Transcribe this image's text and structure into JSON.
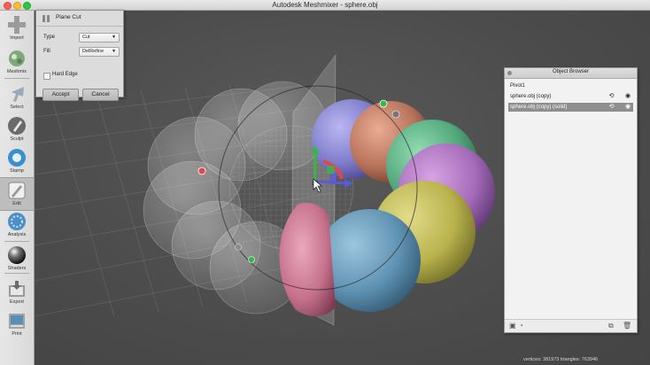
{
  "window": {
    "title": "Autodesk Meshmixer - sphere.obj"
  },
  "toolbar": {
    "items": [
      {
        "label": "Import",
        "icon": "plus-icon"
      },
      {
        "label": "Meshmix",
        "icon": "meshmix-icon"
      },
      {
        "label": "Select",
        "icon": "select-arrow-icon"
      },
      {
        "label": "Sculpt",
        "icon": "brush-icon"
      },
      {
        "label": "Stamp",
        "icon": "stamp-icon"
      },
      {
        "label": "Edit",
        "icon": "edit-icon"
      },
      {
        "label": "Analysis",
        "icon": "analysis-icon"
      },
      {
        "label": "Shaders",
        "icon": "shader-sphere-icon"
      },
      {
        "label": "Export",
        "icon": "export-icon"
      },
      {
        "label": "Print",
        "icon": "print-icon"
      }
    ],
    "active": "Edit"
  },
  "plane_cut": {
    "title": "Plane Cut",
    "type_label": "Type",
    "type_value": "Cut",
    "fill_label": "Fill",
    "fill_value": "DelRefine",
    "hard_edge_label": "Hard Edge",
    "hard_edge_checked": false,
    "accept_label": "Accept",
    "cancel_label": "Cancel"
  },
  "object_browser": {
    "title": "Object Browser",
    "items": [
      {
        "name": "Pivot1",
        "selected": false,
        "has_icons": false
      },
      {
        "name": "sphere.obj (copy)",
        "selected": false,
        "has_icons": true
      },
      {
        "name": "sphere.obj (copy) (solid)",
        "selected": true,
        "has_icons": true
      }
    ],
    "footer_icons": [
      "cube-icon",
      "pie-icon",
      "duplicate-icon",
      "trash-icon"
    ]
  },
  "status": {
    "stats_text": "vertices: 381973  triangles: 763946"
  },
  "colors": {
    "sphere_blue": "#6a9dbd",
    "sphere_pink": "#d07f98",
    "sphere_yellow": "#c9c25a",
    "sphere_purple": "#b678c9",
    "sphere_green": "#5fb889",
    "sphere_orange": "#c7826a",
    "sphere_violet": "#8a88d6",
    "gizmo_green": "#39b54a",
    "gizmo_red": "#e04848",
    "gizmo_blue": "#5a5ad8"
  }
}
